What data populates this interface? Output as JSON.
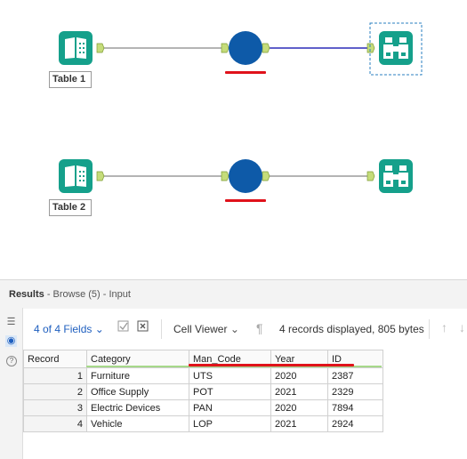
{
  "canvas": {
    "workflows": [
      {
        "input_label": "Table 1"
      },
      {
        "input_label": "Table 2"
      }
    ]
  },
  "results": {
    "title": "Results",
    "subtitle": "- Browse (5) - Input"
  },
  "toolbar": {
    "fields_label": "4 of 4 Fields",
    "viewer_label": "Cell Viewer",
    "status": "4 records displayed, 805 bytes"
  },
  "table": {
    "columns": [
      "Record",
      "Category",
      "Man_Code",
      "Year",
      "ID"
    ],
    "rows": [
      [
        "1",
        "Furniture",
        "UTS",
        "2020",
        "2387"
      ],
      [
        "2",
        "Office Supply",
        "POT",
        "2021",
        "2329"
      ],
      [
        "3",
        "Electric Devices",
        "PAN",
        "2020",
        "7894"
      ],
      [
        "4",
        "Vehicle",
        "LOP",
        "2021",
        "2924"
      ]
    ]
  },
  "colors": {
    "tool_teal": "#15a08b",
    "circle_blue": "#0e5aa8",
    "wire_selected": "#2b2bb8",
    "highlight_red": "#e0121b"
  }
}
